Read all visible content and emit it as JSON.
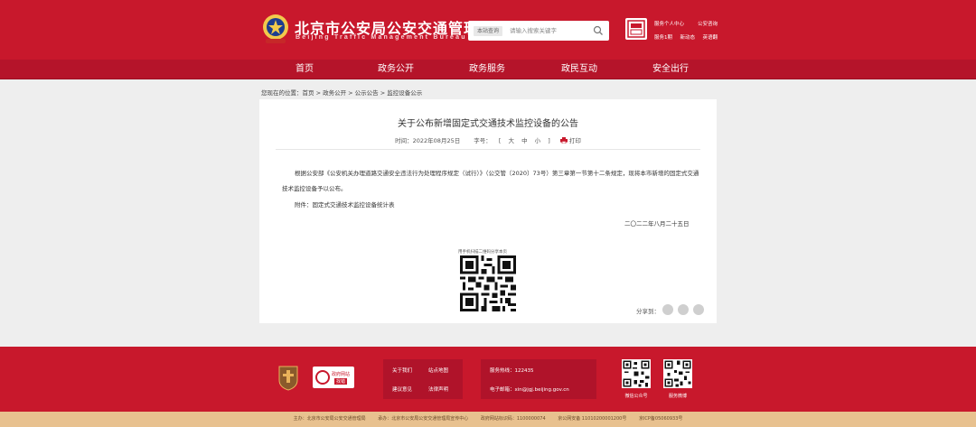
{
  "header": {
    "site_title": "北京市公安局公安交通管理局",
    "site_subtitle": "Beijing Traffic Management Bureau",
    "search_scope": "本站查询",
    "search_placeholder": "请输入搜索关键字",
    "mobile_label": "",
    "links": [
      "服务个人中心",
      "公安咨询",
      "服务1期",
      "新动态",
      "英语翻"
    ],
    "brand_color": "#c8182c"
  },
  "nav": {
    "items": [
      "首页",
      "政务公开",
      "政务服务",
      "政民互动",
      "安全出行"
    ]
  },
  "breadcrumb": {
    "text": "您现在的位置：首页 > 政务公开 > 公示公告 > 监控设备公示"
  },
  "article": {
    "title": "关于公布新增固定式交通技术监控设备的公告",
    "date_label": "时间：",
    "date": "2022年08月25日",
    "font_label": "字号：",
    "font_sizes": [
      "[",
      "大",
      "中",
      "小",
      "]"
    ],
    "print_label": "打印",
    "paragraph": "根据公安部《公安机关办理道路交通安全违法行为处理程序规定（试行）》（公交管〔2020〕73号）第三章第一节第十二条规定，现将本市新增的固定式交通技术监控设备予以公布。",
    "attachment_label": "附件：",
    "attachment_text": "固定式交通技术监控设备统计表",
    "sign_date": "二〇二二年八月二十五日",
    "qr_caption": "用手机扫描二维码分享本页",
    "share_label": "分享到："
  },
  "footer": {
    "gov_badge": {
      "line1": "政府网站",
      "line2": "找错"
    },
    "links": [
      "关于我们",
      "站点地图",
      "建议意见",
      "法律声明"
    ],
    "hotline_label": "服务热线：",
    "hotline": "122435",
    "email_label": "电子邮箱：",
    "email": "xin@jgj.beijing.gov.cn",
    "qr_labels": [
      "微信公众号",
      "服务微博"
    ],
    "bottom": [
      "主办：北京市公安局公安交通管理局",
      "承办：北京市公安局公安交通管理局宣传中心",
      "政府网站标识码：1100000074",
      "京公网安备 11010200001200号",
      "京ICP备05060933号"
    ]
  }
}
